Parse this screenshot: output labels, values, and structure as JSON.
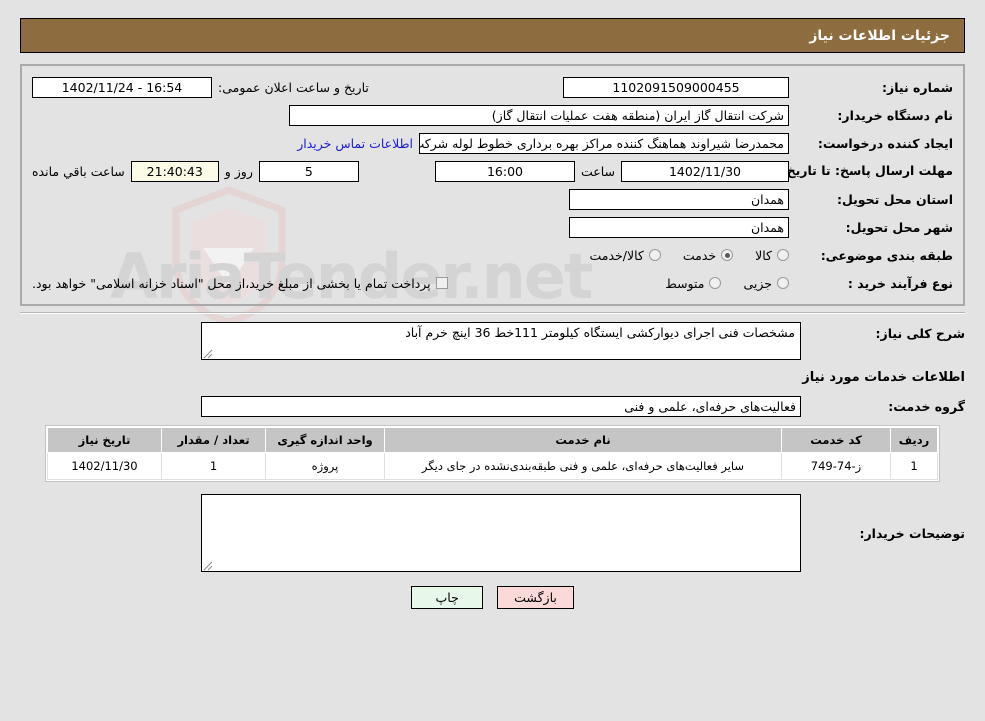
{
  "header": {
    "title": "جزئیات اطلاعات نیاز"
  },
  "watermark": {
    "text": "AriaTender.net"
  },
  "form": {
    "need_number": {
      "label": "شماره نیاز:",
      "value": "1102091509000455"
    },
    "announce": {
      "label": "تاریخ و ساعت اعلان عمومی:",
      "value": "16:54 - 1402/11/24"
    },
    "buyer_org": {
      "label": "نام دستگاه خریدار:",
      "value": "شرکت انتقال گاز ایران (منطقه هفت عملیات انتقال گاز)"
    },
    "requester": {
      "label": "ایجاد کننده درخواست:",
      "value": "محمدرضا شیراوند هماهنگ کننده مراکز بهره برداری خطوط لوله  شرکت انتقال گا",
      "contact_link": "اطلاعات تماس خریدار"
    },
    "deadline": {
      "label": "مهلت ارسال پاسخ: تا تاریخ:",
      "date": "1402/11/30",
      "hour_label": "ساعت",
      "hour": "16:00",
      "days": "5",
      "days_label": "روز و",
      "clock": "21:40:43",
      "remaining_label": "ساعت باقي مانده"
    },
    "province": {
      "label": "استان محل تحویل:",
      "value": "همدان"
    },
    "city": {
      "label": "شهر محل تحویل:",
      "value": "همدان"
    },
    "category": {
      "label": "طبقه بندی موضوعی:",
      "options": [
        {
          "label": "کالا",
          "selected": false
        },
        {
          "label": "خدمت",
          "selected": true
        },
        {
          "label": "کالا/خدمت",
          "selected": false
        }
      ]
    },
    "process": {
      "label": "نوع فرآیند خرید :",
      "options": [
        {
          "label": "جزیی",
          "selected": false
        },
        {
          "label": "متوسط",
          "selected": false
        }
      ],
      "checkbox_label": "پرداخت تمام یا بخشی از مبلغ خرید،از محل \"اسناد خزانه اسلامی\" خواهد بود.",
      "checkbox_checked": false
    }
  },
  "need_description": {
    "label": "شرح کلی نیاز:",
    "value": "مشخصات فنی اجرای دیوارکشی ایستگاه کیلومتر 111خط 36 اینچ خرم آباد"
  },
  "services_section": {
    "heading": "اطلاعات خدمات مورد نیاز",
    "group_label": "گروه خدمت:",
    "group_value": "فعالیت‌های حرفه‌ای، علمی و فنی"
  },
  "table": {
    "columns": [
      "ردیف",
      "کد خدمت",
      "نام خدمت",
      "واحد اندازه گیری",
      "تعداد / مقدار",
      "تاریخ نیاز"
    ],
    "rows": [
      {
        "index": "1",
        "code": "ز-74-749",
        "name": "سایر فعالیت‌های حرفه‌ای، علمی و فنی طبقه‌بندی‌نشده در جای دیگر",
        "unit": "پروژه",
        "qty": "1",
        "date": "1402/11/30"
      }
    ]
  },
  "comments": {
    "label": "توضیحات خریدار:",
    "value": ""
  },
  "buttons": {
    "print": "چاپ",
    "back": "بازگشت"
  },
  "colors": {
    "titlebar": "#8d6d3f",
    "page_bg": "#e3e3e3",
    "link": "#1a1ad6",
    "print_btn": "#e8f8e8",
    "back_btn": "#fbd9d9",
    "table_header": "#c5c5c5"
  }
}
